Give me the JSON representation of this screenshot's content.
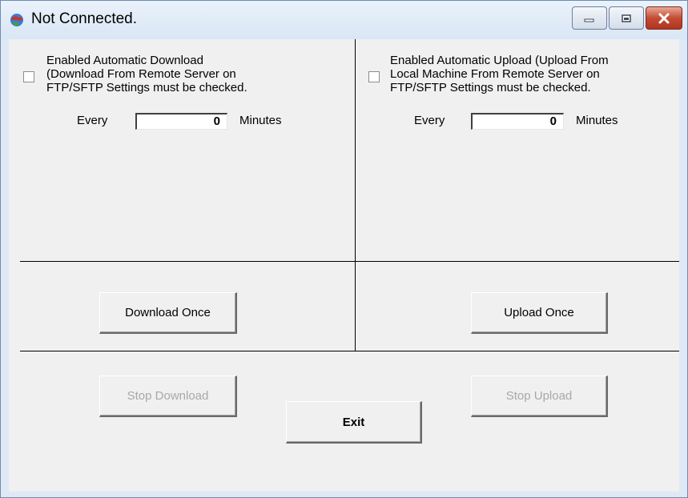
{
  "window": {
    "title": "Not Connected.",
    "accent": "#c44b33"
  },
  "download": {
    "checkbox_label": "Enabled Automatic Download\n(Download From Remote Server on\nFTP/SFTP Settings must be checked.",
    "checked": false,
    "every_label": "Every",
    "minutes_value": "0",
    "minutes_label": "Minutes",
    "once_button": "Download Once",
    "stop_button": "Stop Download"
  },
  "upload": {
    "checkbox_label": "Enabled Automatic Upload (Upload From\nLocal Machine From Remote Server on\nFTP/SFTP Settings must be checked.",
    "checked": false,
    "every_label": "Every",
    "minutes_value": "0",
    "minutes_label": "Minutes",
    "once_button": "Upload Once",
    "stop_button": "Stop Upload"
  },
  "exit_button": "Exit"
}
